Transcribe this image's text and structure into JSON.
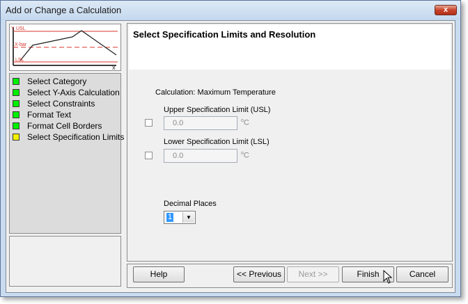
{
  "window": {
    "title": "Add or Change a Calculation",
    "close_symbol": "x"
  },
  "thumbnail": {
    "usl_label": "USL",
    "y_label": "Y",
    "xbar_label": "X-bar",
    "lsl_label": "LSL",
    "x_label": "X"
  },
  "steps": [
    {
      "label": "Select Category",
      "status": "complete",
      "color": "#00ee00"
    },
    {
      "label": "Select Y-Axis Calculation",
      "status": "complete",
      "color": "#00ee00"
    },
    {
      "label": "Select Constraints",
      "status": "complete",
      "color": "#00ee00"
    },
    {
      "label": "Format Text",
      "status": "complete",
      "color": "#00ee00"
    },
    {
      "label": "Format Cell Borders",
      "status": "complete",
      "color": "#00ee00"
    },
    {
      "label": "Select Specification Limits",
      "status": "current",
      "color": "#f2f200"
    }
  ],
  "main": {
    "heading": "Select Specification Limits and Resolution",
    "calculation_label": "Calculation: Maximum Temperature",
    "usl": {
      "label": "Upper Specification Limit (USL)",
      "value": "0.0",
      "unit_symbol": "o",
      "unit": "C",
      "checked": false
    },
    "lsl": {
      "label": "Lower Specification Limit (LSL)",
      "value": "0.0",
      "unit_symbol": "o",
      "unit": "C",
      "checked": false
    },
    "decimal_places": {
      "label": "Decimal Places",
      "value": "1"
    }
  },
  "buttons": {
    "help": "Help",
    "previous": "<< Previous",
    "next": "Next >>",
    "finish": "Finish",
    "cancel": "Cancel"
  },
  "colors": {
    "complete": "#00ee00",
    "current": "#f2f200",
    "spec_line": "#d9342b"
  }
}
